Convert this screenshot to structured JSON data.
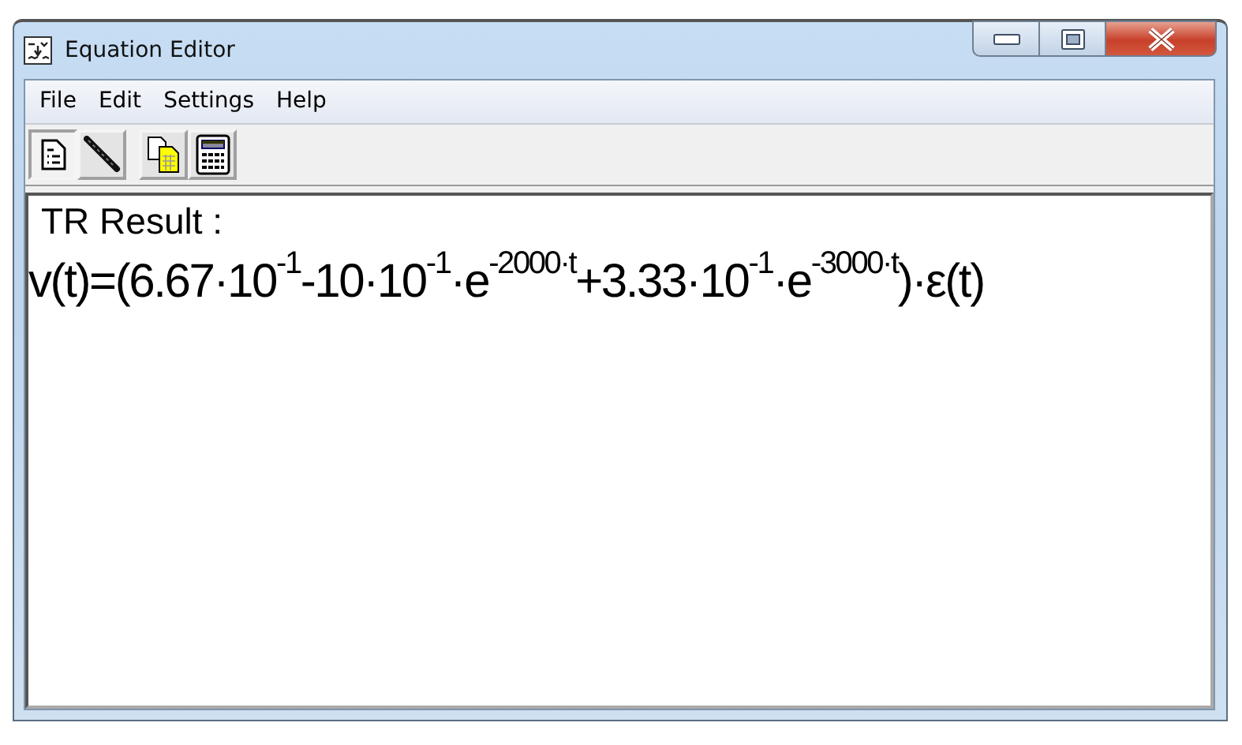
{
  "window": {
    "title": "Equation Editor"
  },
  "menu": [
    {
      "label": "File"
    },
    {
      "label": "Edit"
    },
    {
      "label": "Settings"
    },
    {
      "label": "Help"
    }
  ],
  "toolbar": [
    {
      "buttons": [
        {
          "kind": "document",
          "selected": true
        },
        {
          "kind": "pen",
          "selected": false
        }
      ]
    },
    {
      "buttons": [
        {
          "kind": "copy",
          "selected": false
        },
        {
          "kind": "calculator",
          "selected": false
        }
      ]
    }
  ],
  "content": {
    "heading": "TR Result :",
    "equation": "v(t)=(6.67·10$^{-1}$-10·10$^{-1}$·e$^{-2000·t}$+3.33·10$^{-1}$·e$^{-3000·t}$)·ε(t)"
  }
}
